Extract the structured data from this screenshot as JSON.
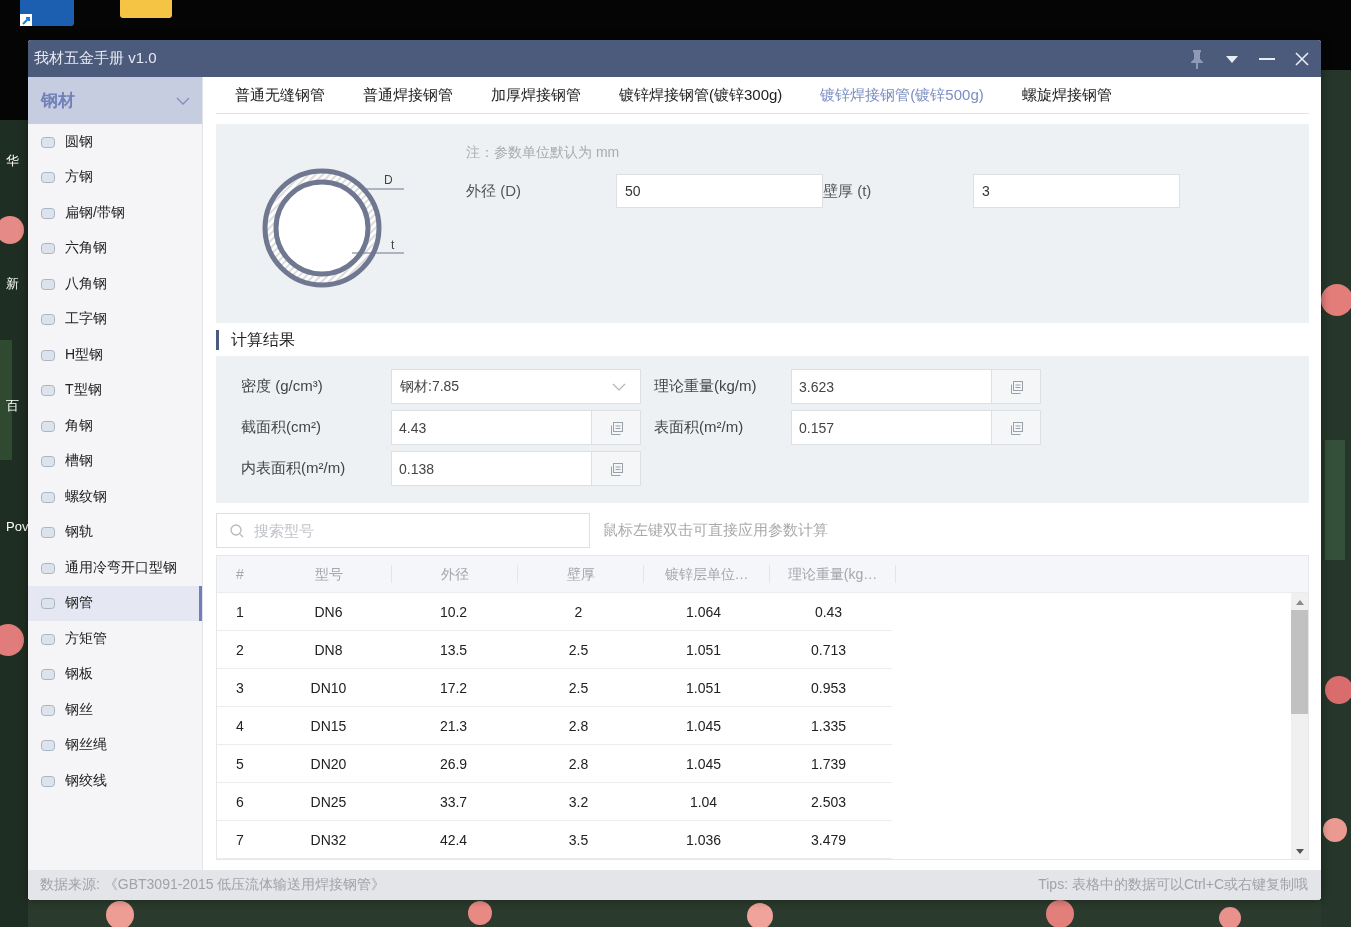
{
  "desktop": {
    "icons": [
      {
        "kind": "app"
      },
      {
        "kind": "folder"
      }
    ],
    "edge_labels": [
      "华",
      "新",
      "百",
      "Pov"
    ]
  },
  "window": {
    "title": "我材五金手册 v1.0"
  },
  "sidebar": {
    "category": "钢材",
    "items": [
      {
        "label": "圆钢",
        "selected": false
      },
      {
        "label": "方钢",
        "selected": false
      },
      {
        "label": "扁钢/带钢",
        "selected": false
      },
      {
        "label": "六角钢",
        "selected": false
      },
      {
        "label": "八角钢",
        "selected": false
      },
      {
        "label": "工字钢",
        "selected": false
      },
      {
        "label": "H型钢",
        "selected": false
      },
      {
        "label": "T型钢",
        "selected": false
      },
      {
        "label": "角钢",
        "selected": false
      },
      {
        "label": "槽钢",
        "selected": false
      },
      {
        "label": "螺纹钢",
        "selected": false
      },
      {
        "label": "钢轨",
        "selected": false
      },
      {
        "label": "通用冷弯开口型钢",
        "selected": false
      },
      {
        "label": "钢管",
        "selected": true
      },
      {
        "label": "方矩管",
        "selected": false
      },
      {
        "label": "钢板",
        "selected": false
      },
      {
        "label": "钢丝",
        "selected": false
      },
      {
        "label": "钢丝绳",
        "selected": false
      },
      {
        "label": "钢绞线",
        "selected": false
      }
    ]
  },
  "tabs": [
    {
      "label": "普通无缝钢管",
      "selected": false
    },
    {
      "label": "普通焊接钢管",
      "selected": false
    },
    {
      "label": "加厚焊接钢管",
      "selected": false
    },
    {
      "label": "镀锌焊接钢管(镀锌300g)",
      "selected": false
    },
    {
      "label": "镀锌焊接钢管(镀锌500g)",
      "selected": true
    },
    {
      "label": "螺旋焊接钢管",
      "selected": false
    }
  ],
  "params": {
    "note": "注：参数单位默认为 mm",
    "diagram": {
      "d_label": "D",
      "t_label": "t"
    },
    "fields": [
      {
        "label": "外径 (D)",
        "value": "50"
      },
      {
        "label": "壁厚 (t)",
        "value": "3"
      }
    ]
  },
  "results": {
    "title": "计算结果",
    "fields": [
      {
        "label": "密度 (g/cm³)",
        "value": "钢材:7.85",
        "kind": "select"
      },
      {
        "label": "理论重量(kg/m)",
        "value": "3.623",
        "kind": "copy"
      },
      {
        "label": "截面积(cm²)",
        "value": "4.43",
        "kind": "copy"
      },
      {
        "label": "表面积(m²/m)",
        "value": "0.157",
        "kind": "copy"
      },
      {
        "label": "内表面积(m²/m)",
        "value": "0.138",
        "kind": "copy"
      }
    ]
  },
  "search": {
    "placeholder": "搜索型号",
    "hint": "鼠标左键双击可直接应用参数计算"
  },
  "table": {
    "columns": [
      "#",
      "型号",
      "外径",
      "壁厚",
      "镀锌层单位…",
      "理论重量(kg…"
    ],
    "rows": [
      [
        "1",
        "DN6",
        "10.2",
        "2",
        "1.064",
        "0.43"
      ],
      [
        "2",
        "DN8",
        "13.5",
        "2.5",
        "1.051",
        "0.713"
      ],
      [
        "3",
        "DN10",
        "17.2",
        "2.5",
        "1.051",
        "0.953"
      ],
      [
        "4",
        "DN15",
        "21.3",
        "2.8",
        "1.045",
        "1.335"
      ],
      [
        "5",
        "DN20",
        "26.9",
        "2.8",
        "1.045",
        "1.739"
      ],
      [
        "6",
        "DN25",
        "33.7",
        "3.2",
        "1.04",
        "2.503"
      ],
      [
        "7",
        "DN32",
        "42.4",
        "3.5",
        "1.036",
        "3.479"
      ]
    ]
  },
  "status_bar": {
    "source": "数据来源: 《GBT3091-2015 低压流体输送用焊接钢管》",
    "tips": "Tips: 表格中的数据可以Ctrl+C或右键复制哦"
  }
}
